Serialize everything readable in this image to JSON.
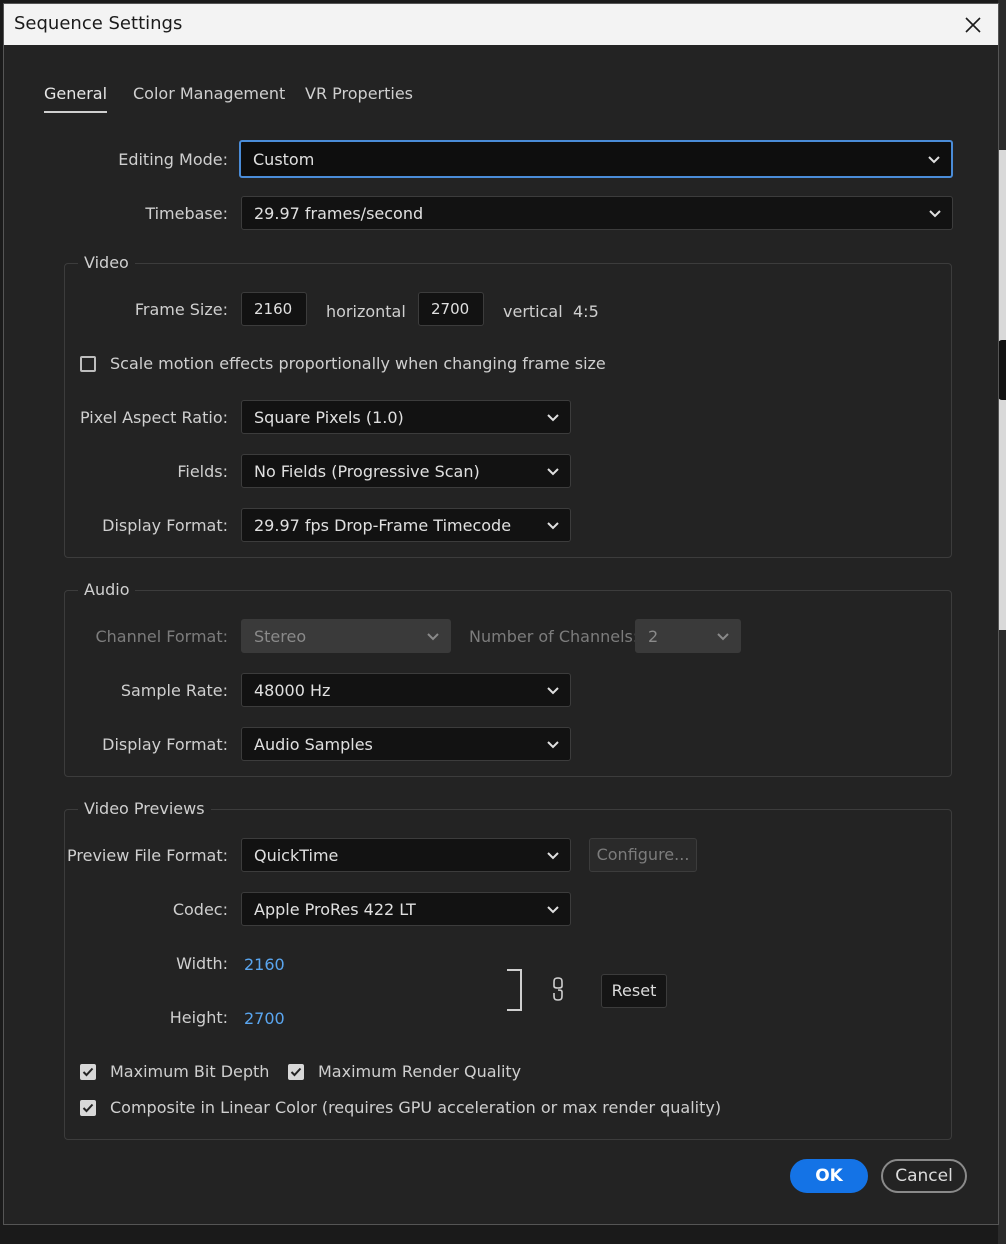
{
  "window": {
    "title": "Sequence Settings"
  },
  "tabs": [
    {
      "label": "General",
      "active": true
    },
    {
      "label": "Color Management",
      "active": false
    },
    {
      "label": "VR Properties",
      "active": false
    }
  ],
  "general": {
    "editing_mode": {
      "label": "Editing Mode:",
      "value": "Custom"
    },
    "timebase": {
      "label": "Timebase:",
      "value": "29.97  frames/second"
    }
  },
  "video": {
    "title": "Video",
    "frame_size": {
      "label": "Frame Size:",
      "horizontal": "2160",
      "horizontal_label": "horizontal",
      "vertical": "2700",
      "vertical_label": "vertical",
      "ratio": "4:5"
    },
    "scale_motion": {
      "label": "Scale motion effects proportionally when changing frame size",
      "checked": false
    },
    "pixel_aspect_ratio": {
      "label": "Pixel Aspect Ratio:",
      "value": "Square Pixels (1.0)"
    },
    "fields": {
      "label": "Fields:",
      "value": "No Fields (Progressive Scan)"
    },
    "display_format": {
      "label": "Display Format:",
      "value": "29.97 fps Drop-Frame Timecode"
    }
  },
  "audio": {
    "title": "Audio",
    "channel_format": {
      "label": "Channel Format:",
      "value": "Stereo"
    },
    "num_channels": {
      "label": "Number of Channels:",
      "value": "2"
    },
    "sample_rate": {
      "label": "Sample Rate:",
      "value": "48000 Hz"
    },
    "display_format": {
      "label": "Display Format:",
      "value": "Audio Samples"
    }
  },
  "previews": {
    "title": "Video Previews",
    "file_format": {
      "label": "Preview File Format:",
      "value": "QuickTime"
    },
    "configure_label": "Configure...",
    "codec": {
      "label": "Codec:",
      "value": "Apple ProRes 422 LT"
    },
    "width": {
      "label": "Width:",
      "value": "2160"
    },
    "height": {
      "label": "Height:",
      "value": "2700"
    },
    "reset_label": "Reset",
    "max_bit_depth": {
      "label": "Maximum Bit Depth",
      "checked": true
    },
    "max_render_quality": {
      "label": "Maximum Render Quality",
      "checked": true
    },
    "linear_color": {
      "label": "Composite in Linear Color (requires GPU acceleration or max render quality)",
      "checked": true
    }
  },
  "buttons": {
    "ok": "OK",
    "cancel": "Cancel"
  },
  "icons": {
    "close": "close-icon",
    "chevron": "chevron-down-icon",
    "link": "link-icon",
    "bracket": "link-bracket-icon",
    "check": "checkmark-icon"
  },
  "colors": {
    "accent": "#1473e6",
    "focus": "#4a8cd8",
    "link": "#5aa6f0",
    "background": "#232323"
  }
}
